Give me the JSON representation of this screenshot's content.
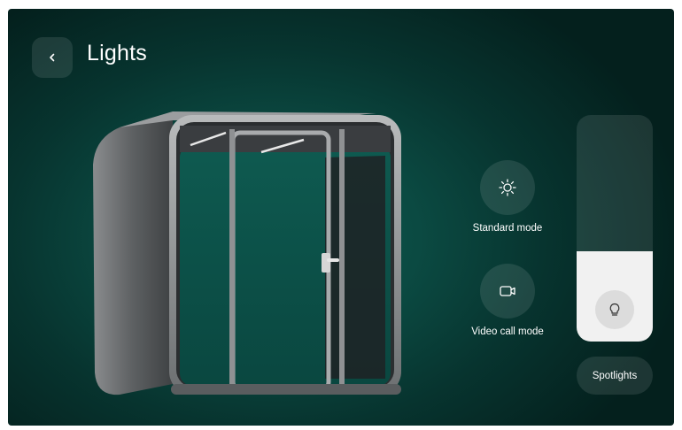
{
  "header": {
    "title": "Lights",
    "back_icon": "chevron-left-icon"
  },
  "modes": [
    {
      "label": "Standard mode",
      "icon": "sun-icon"
    },
    {
      "label": "Video call mode",
      "icon": "video-camera-icon"
    }
  ],
  "brightness": {
    "level": 0.4,
    "icon": "lightbulb-icon"
  },
  "spotlights": {
    "label": "Spotlights"
  },
  "colors": {
    "background": "#0b4a42",
    "text": "#ffffff",
    "slider_fill": "#f1f1f1"
  }
}
